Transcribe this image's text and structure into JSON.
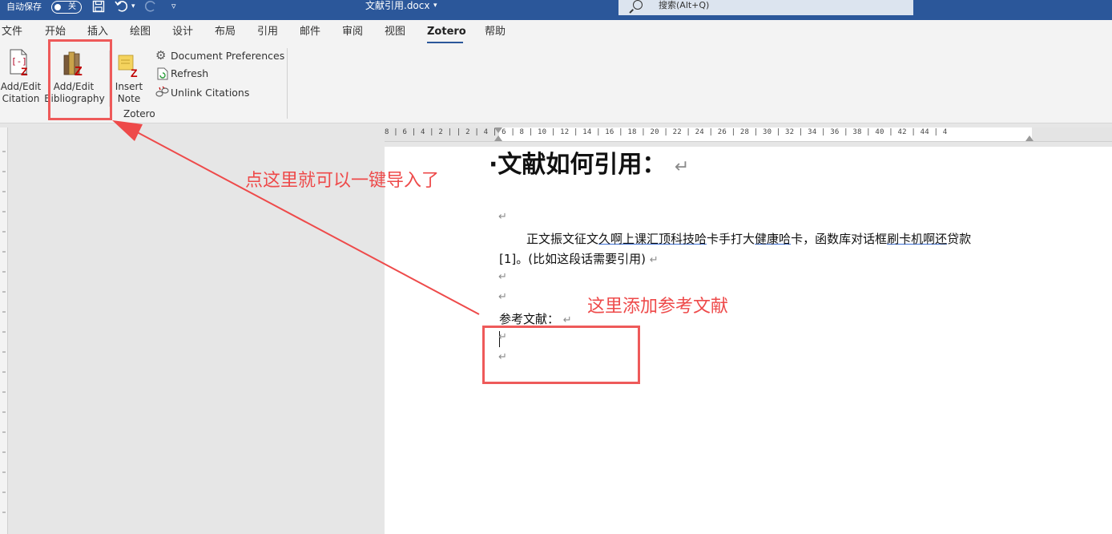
{
  "titlebar": {
    "autosave_label": "自动保存",
    "autosave_state": "关",
    "doc_title": "文献引用.docx",
    "search_placeholder": "搜索(Alt+Q)",
    "accent_color": "#2b579a"
  },
  "tabs": [
    {
      "label": "文件"
    },
    {
      "label": "开始"
    },
    {
      "label": "插入"
    },
    {
      "label": "绘图"
    },
    {
      "label": "设计"
    },
    {
      "label": "布局"
    },
    {
      "label": "引用"
    },
    {
      "label": "邮件"
    },
    {
      "label": "审阅"
    },
    {
      "label": "视图"
    },
    {
      "label": "Zotero",
      "active": true
    },
    {
      "label": "帮助"
    }
  ],
  "ribbon": {
    "add_edit_citation": {
      "line1": "Add/Edit",
      "line2": "Citation"
    },
    "add_edit_bibliography": {
      "line1": "Add/Edit",
      "line2": "Bibliography"
    },
    "insert_note": {
      "line1": "Insert",
      "line2": "Note"
    },
    "document_preferences": "Document Preferences",
    "refresh": "Refresh",
    "unlink_citations": "Unlink Citations",
    "group_label": "Zotero"
  },
  "ruler": {
    "text": "8 | 6 | 4 | 2 |     | 2 | 4 | 6 | 8 | 10 | 12 | 14 | 16 | 18 | 20 | 22 | 24 | 26 | 28 | 30 | 32 | 34 | 36 | 38 | 40 | 42 | 44 | 4"
  },
  "document": {
    "heading": "·文献如何引用：",
    "body_line1_a": "正文振文征文",
    "body_line1_b": "久啊上课汇顶科技哈",
    "body_line1_c": "卡手打大",
    "body_line1_d": "健康哈",
    "body_line1_e": "卡，函数库对话框",
    "body_line1_f": "刷卡机啊还",
    "body_line1_g": "贷款",
    "body_line2": "[1]。(比如这段话需要引用)",
    "references_label": "参考文献：",
    "para_mark": "↵"
  },
  "annotations": {
    "text_bibliography": "点这里就可以一键导入了",
    "text_references": "这里添加参考文献",
    "color": "#ee4a4a"
  }
}
